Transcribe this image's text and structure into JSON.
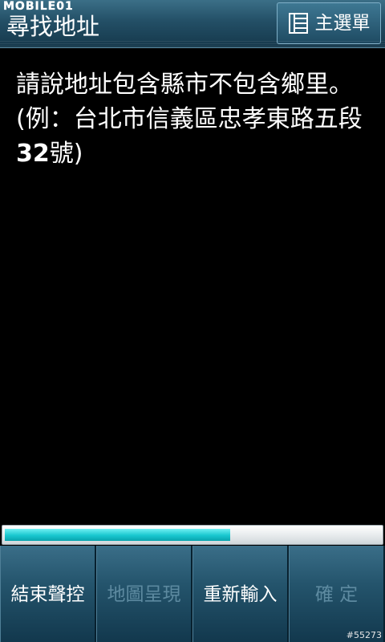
{
  "header": {
    "watermark": "MOBILE01",
    "title": "尋找地址",
    "menu_label": "主選單",
    "menu_icon": "list-menu-icon"
  },
  "prompt": {
    "line_text": "請說地址包含縣市不包含鄉里。(例：台北市信義區忠孝東路五段",
    "number": "32",
    "suffix": "號)"
  },
  "progress": {
    "fraction": 0.6
  },
  "buttons": [
    {
      "label": "結束聲控",
      "enabled": true
    },
    {
      "label": "地圖呈現",
      "enabled": false
    },
    {
      "label": "重新輸入",
      "enabled": true
    },
    {
      "label": "確 定",
      "enabled": false
    }
  ],
  "footer": {
    "id": "#55273"
  },
  "colors": {
    "header_bg": "#234f66",
    "progress_fill": "#18c7cf",
    "button_bg": "#24546c",
    "disabled_text": "#5d8aa0"
  }
}
